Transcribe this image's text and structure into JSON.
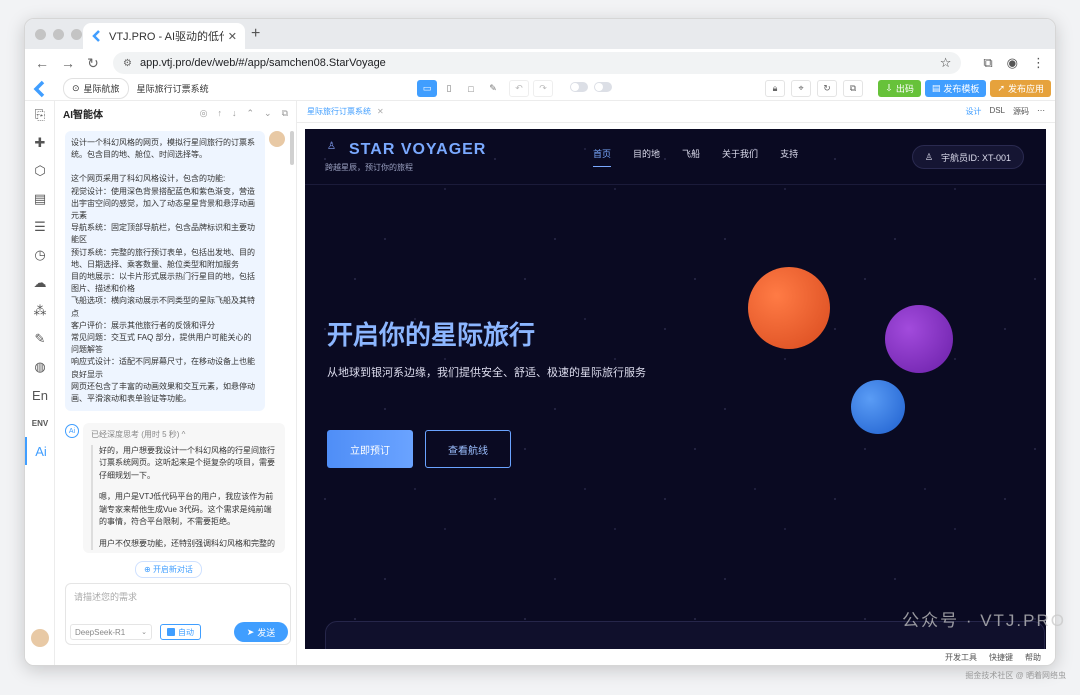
{
  "browser": {
    "tab_title": "VTJ.PRO - AI驱动的低代码开发",
    "url": "app.vtj.pro/dev/web/#/app/samchen08.StarVoyage"
  },
  "toolbar": {
    "crumb_app": "星际航旅",
    "crumb_page": "星际旅行订票系统",
    "export": "出码",
    "publish_template": "发布模板",
    "publish_app": "发布应用"
  },
  "ai_panel": {
    "title": "AI智能体",
    "user_message": [
      "设计一个科幻风格的网页，模拟行星间旅行的订票系统。包含目的地、舱位、时间选择等。",
      "这个网页采用了科幻风格设计，包含的功能:",
      "视觉设计：使用深色背景搭配蓝色和紫色渐变，营造出宇宙空间的感觉，加入了动态星星背景和悬浮动画元素",
      "导航系统：固定顶部导航栏，包含品牌标识和主要功能区",
      "预订系统：完整的旅行预订表单，包括出发地、目的地、日期选择、乘客数量、舱位类型和附加服务",
      "目的地展示：以卡片形式展示热门行星目的地，包括图片、描述和价格",
      "飞船选项：横向滚动展示不同类型的星际飞船及其特点",
      "客户评价：展示其他旅行者的反馈和评分",
      "常见问题：交互式 FAQ 部分，提供用户可能关心的问题解答",
      "响应式设计：适配不同屏幕尺寸，在移动设备上也能良好显示",
      "网页还包含了丰富的动画效果和交互元素，如悬停动画、平滑滚动和表单验证等功能。"
    ],
    "think_label": "已经深度思考 (用时 5 秒) ^",
    "ai_message": [
      "好的，用户想要我设计一个科幻风格的行星间旅行订票系统网页。这听起来是个挺复杂的项目，需要仔细规划一下。",
      "嗯，用户是VTJ低代码平台的用户，我应该作为前端专家来帮他生成Vue 3代码。这个需求是纯前端的事情，符合平台限制，不需要拒绝。",
      "用户不仅想要功能，还特别强调科幻风格和完整的"
    ],
    "new_chat": "开启新对话",
    "input_placeholder": "请描述您的需求",
    "model": "DeepSeek-R1",
    "auto_label": "自动",
    "send_label": "发送"
  },
  "canvas": {
    "tab_label": "星际旅行订票系统",
    "modes": [
      "设计",
      "DSL",
      "源码"
    ]
  },
  "site": {
    "brand": "STAR VOYAGER",
    "slogan": "跨越星辰，预订你的旅程",
    "menu": [
      "首页",
      "目的地",
      "飞船",
      "关于我们",
      "支持"
    ],
    "crew_id": "宇航员ID: XT-001",
    "hero_title": "开启你的星际旅行",
    "hero_subtitle": "从地球到银河系边缘，我们提供安全、舒适、极速的星际旅行服务",
    "book_btn": "立即预订",
    "routes_btn": "查看航线"
  },
  "status": {
    "items": [
      "开发工具",
      "快捷键",
      "帮助"
    ]
  },
  "watermark": "公众号 · VTJ.PRO",
  "credit": "掘金技术社区 @ 晒着网络虫"
}
